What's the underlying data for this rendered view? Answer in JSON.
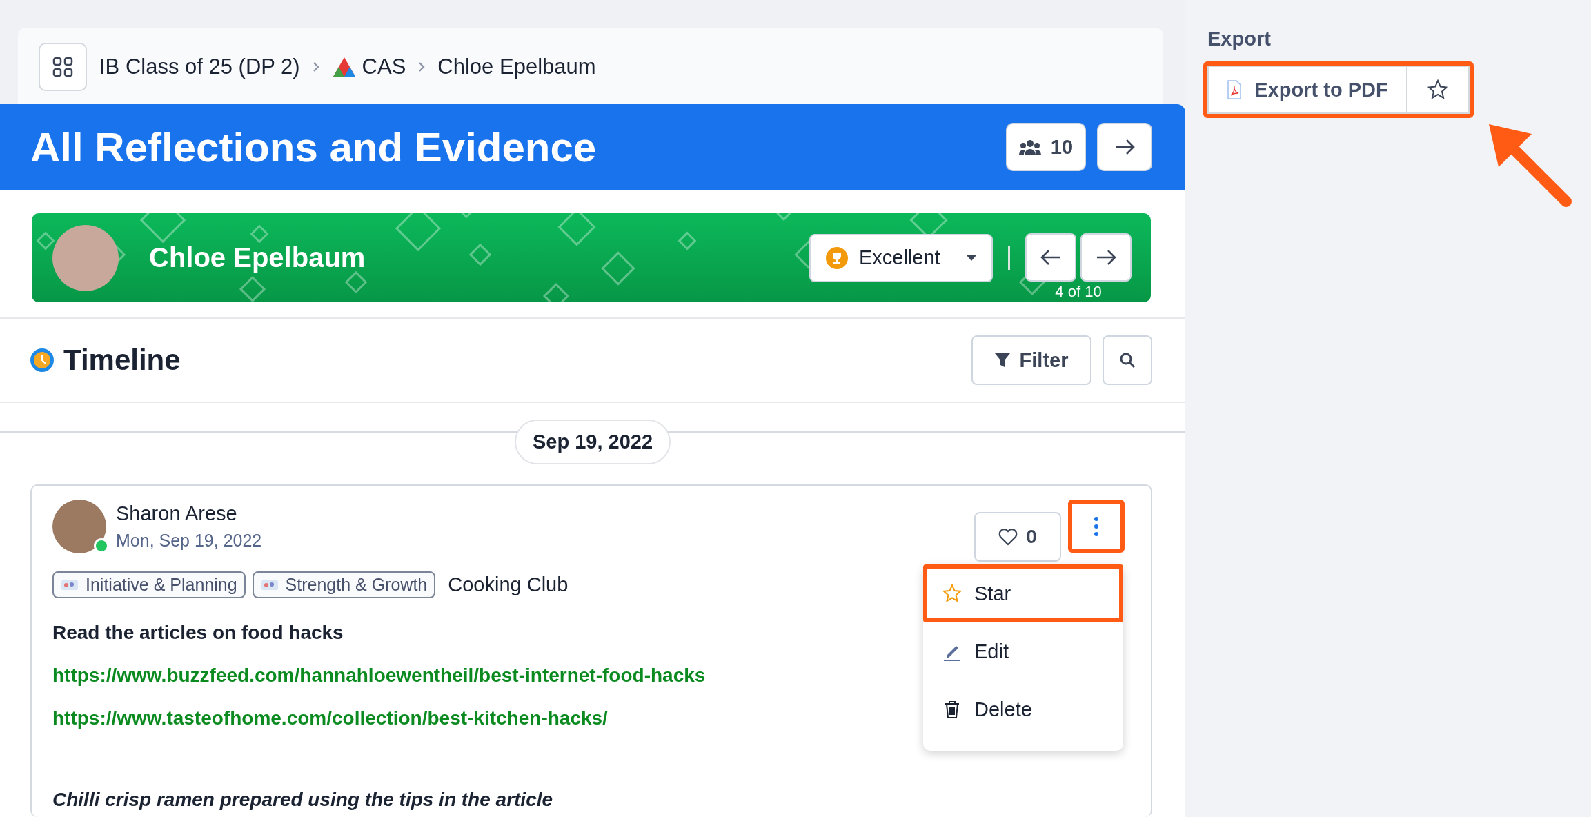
{
  "breadcrumb": {
    "items": [
      {
        "label": "IB Class of 25 (DP 2)",
        "kind": "text"
      },
      {
        "label": "CAS",
        "kind": "cas"
      },
      {
        "label": "Chloe Epelbaum",
        "kind": "text"
      }
    ]
  },
  "header": {
    "title": "All Reflections and Evidence",
    "member_count": "10"
  },
  "student": {
    "name": "Chloe Epelbaum",
    "rating": "Excellent",
    "position": "4 of 10"
  },
  "timeline": {
    "title": "Timeline",
    "filter_label": "Filter"
  },
  "date_divider": "Sep 19, 2022",
  "post": {
    "author": "Sharon Arese",
    "online": true,
    "date": "Mon, Sep 19, 2022",
    "tags": [
      {
        "label": "Initiative & Planning",
        "kind": "tag"
      },
      {
        "label": "Strength & Growth",
        "kind": "tag"
      },
      {
        "label": "Cooking Club",
        "kind": "plain"
      }
    ],
    "likes": "0",
    "liked": false,
    "more_highlighted": true,
    "body": [
      {
        "kind": "heading",
        "text": "Read the articles on food hacks"
      },
      {
        "kind": "link",
        "text": "https://www.buzzfeed.com/hannahloewentheil/best-internet-food-hacks"
      },
      {
        "kind": "link",
        "text": "https://www.tasteofhome.com/collection/best-kitchen-hacks/"
      },
      {
        "kind": "caption",
        "text": "Chilli crisp ramen prepared using the tips in the article"
      }
    ],
    "menu": [
      {
        "label": "Star",
        "kind": "star",
        "highlighted": true
      },
      {
        "label": "Edit",
        "kind": "edit",
        "highlighted": false
      },
      {
        "label": "Delete",
        "kind": "delete",
        "highlighted": false
      }
    ]
  },
  "export": {
    "heading": "Export",
    "button": "Export to PDF",
    "highlighted": true,
    "callout_arrow": true
  }
}
